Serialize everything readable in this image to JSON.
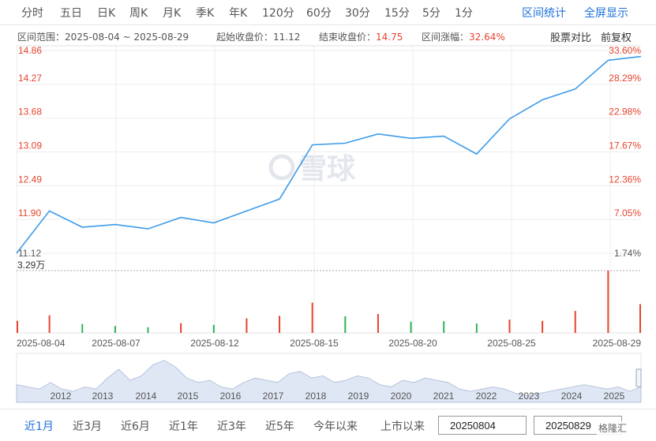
{
  "period_tabs": [
    "分时",
    "五日",
    "日K",
    "周K",
    "月K",
    "季K",
    "年K",
    "120分",
    "60分",
    "30分",
    "15分",
    "5分",
    "1分"
  ],
  "actions": {
    "range_stats": "区间统计",
    "fullscreen": "全屏显示"
  },
  "info": {
    "range_label": "区间范围：",
    "range_value": "2025-08-04 ~ 2025-08-29",
    "start_label": "起始收盘价：",
    "start_value": "11.12",
    "end_label": "结束收盘价：",
    "end_value": "14.75",
    "change_label": "区间涨幅：",
    "change_value": "32.64%",
    "compare_option": "股票对比",
    "adjust_option": "前复权"
  },
  "watermark": "雪球",
  "colors": {
    "line": "#3d9be9",
    "up": "#e6442e",
    "down": "#2eb35a",
    "accent": "#1e6fd9",
    "area": "#c9d6ec"
  },
  "chart_data": [
    {
      "type": "line",
      "x": [
        "2025-08-04",
        "2025-08-05",
        "2025-08-06",
        "2025-08-07",
        "2025-08-08",
        "2025-08-11",
        "2025-08-12",
        "2025-08-13",
        "2025-08-14",
        "2025-08-15",
        "2025-08-18",
        "2025-08-19",
        "2025-08-20",
        "2025-08-21",
        "2025-08-22",
        "2025-08-25",
        "2025-08-26",
        "2025-08-27",
        "2025-08-28",
        "2025-08-29"
      ],
      "values": [
        11.12,
        11.9,
        11.6,
        11.65,
        11.57,
        11.78,
        11.68,
        11.9,
        12.12,
        13.12,
        13.15,
        13.32,
        13.24,
        13.28,
        12.95,
        13.6,
        13.95,
        14.15,
        14.68,
        14.75
      ],
      "y_ticks_left": [
        "14.86",
        "14.27",
        "13.68",
        "13.09",
        "12.49",
        "11.90",
        "11.12"
      ],
      "y_ticks_right": [
        "33.60%",
        "28.29%",
        "22.98%",
        "17.67%",
        "12.36%",
        "7.05%",
        "1.74%"
      ],
      "ylim": [
        11.12,
        14.86
      ],
      "grid": true
    },
    {
      "type": "bar",
      "x": [
        "2025-08-04",
        "2025-08-05",
        "2025-08-06",
        "2025-08-07",
        "2025-08-08",
        "2025-08-11",
        "2025-08-12",
        "2025-08-13",
        "2025-08-14",
        "2025-08-15",
        "2025-08-18",
        "2025-08-19",
        "2025-08-20",
        "2025-08-21",
        "2025-08-22",
        "2025-08-25",
        "2025-08-26",
        "2025-08-27",
        "2025-08-28",
        "2025-08-29"
      ],
      "volume_max_label": "3.29万",
      "values": [
        0.64,
        0.93,
        0.47,
        0.37,
        0.3,
        0.51,
        0.43,
        0.77,
        0.9,
        1.6,
        0.88,
        1.0,
        0.59,
        0.62,
        0.5,
        0.7,
        0.64,
        1.16,
        3.29,
        1.52
      ],
      "direction": [
        "up",
        "up",
        "down",
        "down",
        "down",
        "up",
        "down",
        "up",
        "up",
        "up",
        "down",
        "up",
        "down",
        "down",
        "down",
        "up",
        "up",
        "up",
        "up",
        "up"
      ],
      "x_tick_labels": [
        "2025-08-04",
        "2025-08-07",
        "2025-08-12",
        "2025-08-15",
        "2025-08-20",
        "2025-08-25",
        "2025-08-29"
      ]
    },
    {
      "type": "area",
      "x_tick_labels": [
        "2012",
        "2013",
        "2014",
        "2015",
        "2016",
        "2017",
        "2018",
        "2019",
        "2020",
        "2021",
        "2022",
        "2023",
        "2024",
        "2025"
      ],
      "values": [
        0.4,
        0.35,
        0.3,
        0.45,
        0.3,
        0.25,
        0.35,
        0.3,
        0.55,
        0.75,
        0.5,
        0.6,
        0.85,
        0.95,
        0.8,
        0.55,
        0.45,
        0.5,
        0.35,
        0.3,
        0.45,
        0.55,
        0.5,
        0.45,
        0.65,
        0.7,
        0.55,
        0.6,
        0.45,
        0.5,
        0.6,
        0.55,
        0.4,
        0.35,
        0.5,
        0.45,
        0.55,
        0.5,
        0.45,
        0.3,
        0.25,
        0.3,
        0.35,
        0.3,
        0.2,
        0.15,
        0.2,
        0.25,
        0.3,
        0.35,
        0.4,
        0.35,
        0.3,
        0.35,
        0.25,
        0.35
      ]
    }
  ],
  "range_buttons": [
    "近1月",
    "近3月",
    "近6月",
    "近1年",
    "近3年",
    "近5年",
    "今年以来",
    "上市以来"
  ],
  "date_from": "20250804",
  "date_to": "20250829",
  "logo_text": "格隆汇"
}
